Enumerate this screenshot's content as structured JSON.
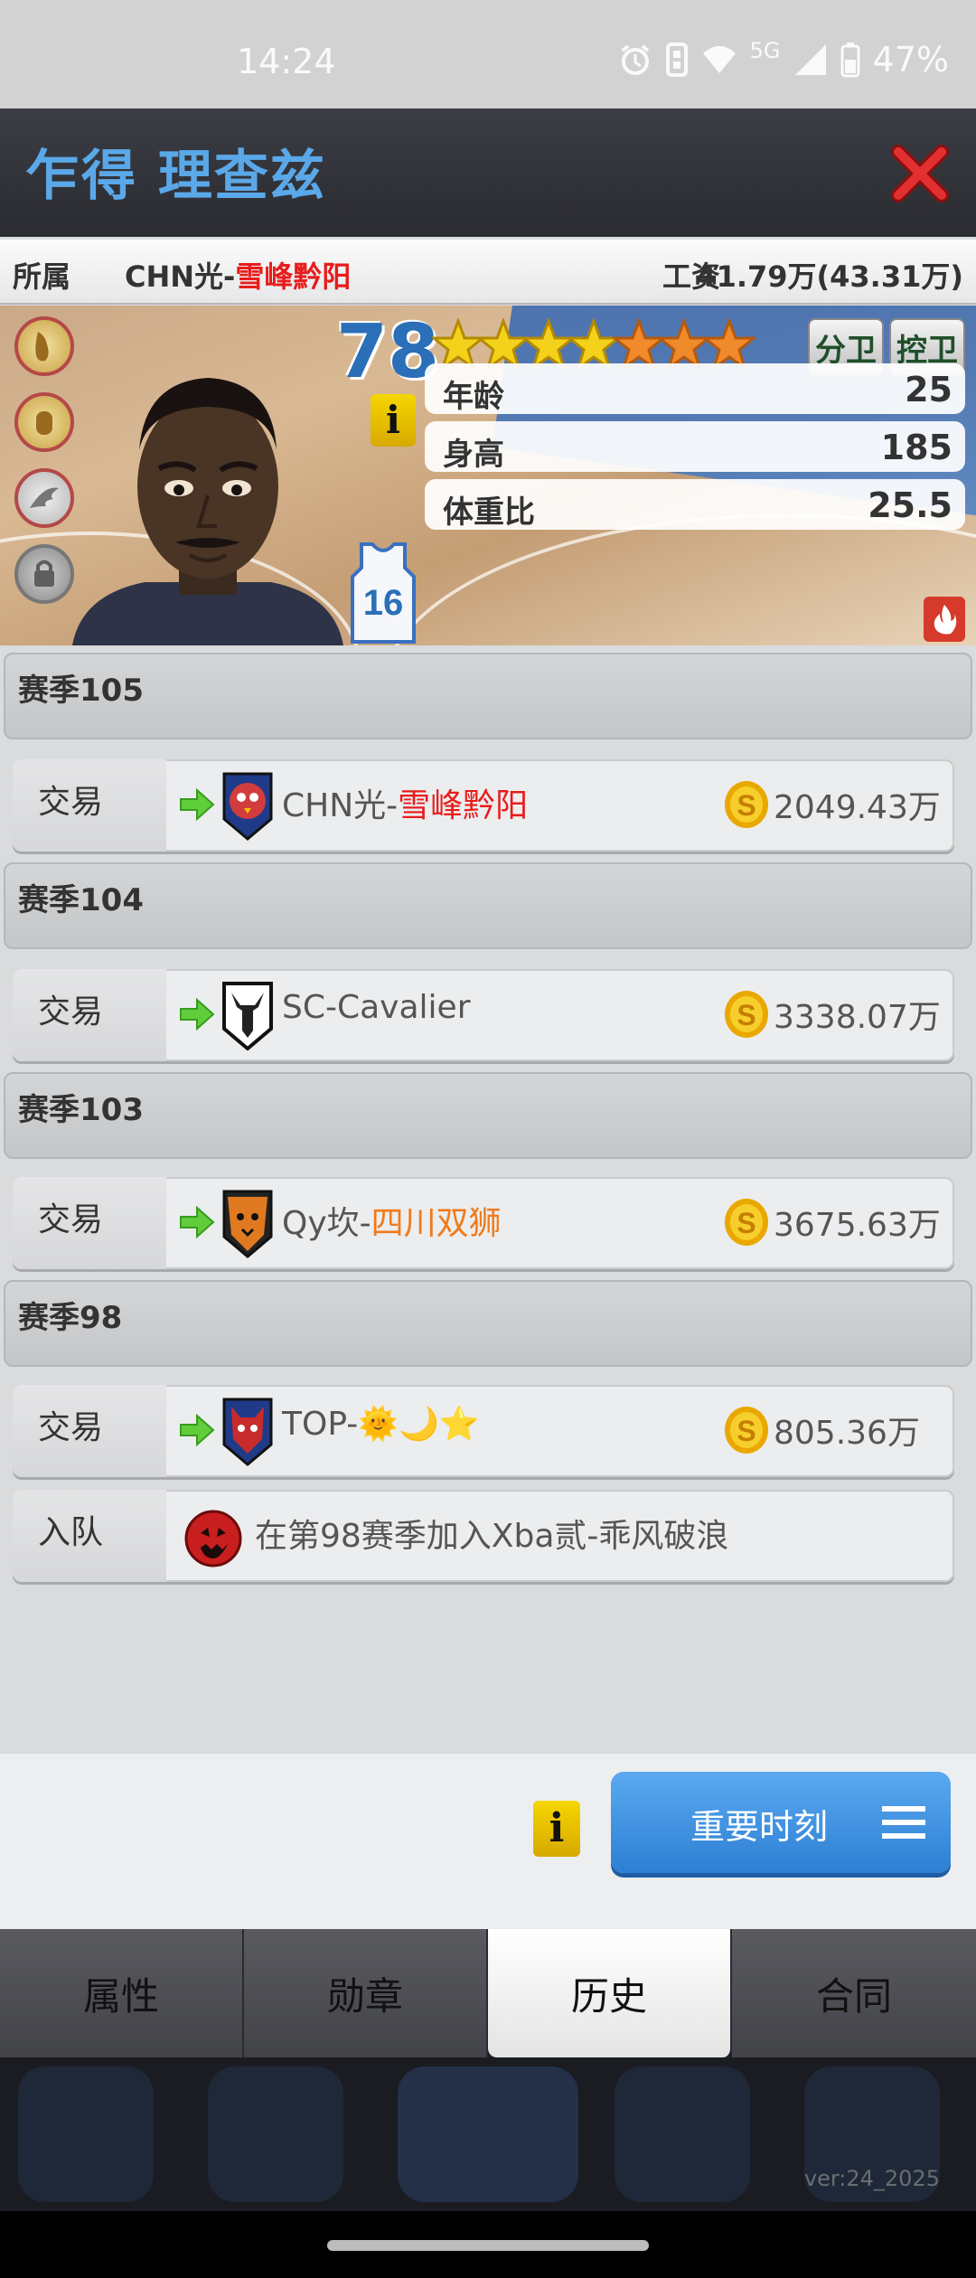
{
  "status_bar": {
    "time": "14:24",
    "network": "5G",
    "battery": "47%"
  },
  "header": {
    "player_name": "乍得 理查兹"
  },
  "team_row": {
    "label": "所属",
    "team_prefix": "CHN光-",
    "team_name": "雪峰黔阳",
    "wage_label": "工资",
    "wage_value": "41.79万(43.31万)"
  },
  "card": {
    "rating": "78",
    "stars": 7,
    "jersey_number": "16",
    "positions": [
      "分卫",
      "控卫"
    ],
    "info_label": "i",
    "stats": [
      {
        "key": "年龄",
        "value": "25"
      },
      {
        "key": "身高",
        "value": "185"
      },
      {
        "key": "体重比",
        "value": "25.5"
      }
    ]
  },
  "history": [
    {
      "season": "赛季105",
      "entries": [
        {
          "type": "交易",
          "prefix": "CHN光-",
          "team": "雪峰黔阳",
          "team_color": "red",
          "amount": "2049.43万",
          "logo": "owl-logo"
        }
      ]
    },
    {
      "season": "赛季104",
      "entries": [
        {
          "type": "交易",
          "prefix": "SC-Cavalier",
          "team": "",
          "team_color": "",
          "amount": "3338.07万",
          "logo": "deer-logo"
        }
      ]
    },
    {
      "season": "赛季103",
      "entries": [
        {
          "type": "交易",
          "prefix": "Qy坎-",
          "team": "四川双狮",
          "team_color": "orange",
          "amount": "3675.63万",
          "logo": "lion-logo"
        }
      ]
    },
    {
      "season": "赛季98",
      "entries": [
        {
          "type": "交易",
          "prefix": "TOP-",
          "team": "🌞🌙⭐",
          "team_color": "emoji",
          "amount": "805.36万",
          "logo": "wolf-logo"
        },
        {
          "type": "入队",
          "text": "在第98赛季加入Xba贰-乖风破浪",
          "logo": "pumpkin-logo"
        }
      ]
    }
  ],
  "actions": {
    "info_label": "i",
    "moments_label": "重要时刻"
  },
  "tabs": [
    "属性",
    "勋章",
    "历史",
    "合同"
  ],
  "active_tab": "历史",
  "footer": {
    "version": "ver:24_2025"
  }
}
